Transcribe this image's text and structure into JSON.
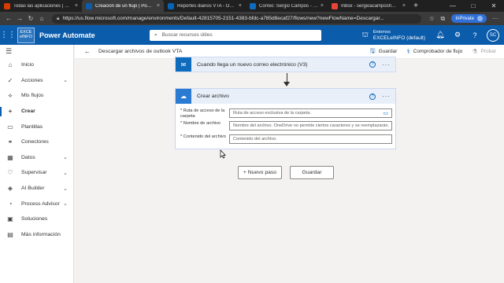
{
  "browser": {
    "tabs": [
      {
        "title": "Todas las aplicaciones | Micros",
        "color": "#d83b01"
      },
      {
        "title": "Creación de un flujo | Power Au",
        "color": "#0b5cab"
      },
      {
        "title": "Reportes diarios VTA - OneDrive",
        "color": "#0364b8"
      },
      {
        "title": "Correo: Sergio Campos - Outlook",
        "color": "#0f6cbd"
      },
      {
        "title": "Inbox - sergioacamposh@gmail.",
        "color": "#ea4335"
      }
    ],
    "url": "https://us.flow.microsoft.com/manage/environments/Default-42815705-2151-4383-bfdc-a785d8ecaf27/flows/new?newFlowName=Descargar...",
    "inprivate_label": "InPrivate"
  },
  "app": {
    "logo_line1": "EXCE",
    "logo_line2": "elNFO",
    "brand": "Power Automate",
    "search_placeholder": "Buscar recursos útiles",
    "env_label": "Entornos",
    "env_name": "EXCELeINFO (default)",
    "user_initials": "SC"
  },
  "sidebar": {
    "items": [
      {
        "label": "Inicio",
        "icon": "⌂",
        "chevron": false
      },
      {
        "label": "Acciones",
        "icon": "✓",
        "chevron": true
      },
      {
        "label": "Mis flujos",
        "icon": "⟡",
        "chevron": false
      },
      {
        "label": "Crear",
        "icon": "+",
        "chevron": false,
        "active": true
      },
      {
        "label": "Plantillas",
        "icon": "▭",
        "chevron": false
      },
      {
        "label": "Conectores",
        "icon": "⚭",
        "chevron": false
      },
      {
        "label": "Datos",
        "icon": "▦",
        "chevron": true
      },
      {
        "label": "Supervisar",
        "icon": "♡",
        "chevron": true
      },
      {
        "label": "AI Builder",
        "icon": "◈",
        "chevron": true
      },
      {
        "label": "Process Advisor",
        "icon": "◔",
        "chevron": true
      },
      {
        "label": "Soluciones",
        "icon": "▣",
        "chevron": false
      },
      {
        "label": "Más información",
        "icon": "▤",
        "chevron": false
      }
    ]
  },
  "commandbar": {
    "breadcrumb": "Descargar archivos de outlook VTA",
    "save": "Guardar",
    "checker": "Comprobador de flujo",
    "test": "Probar"
  },
  "trigger": {
    "title": "Cuando llega un nuevo correo electrónico (V3)"
  },
  "action": {
    "title": "Crear archivo",
    "fields": [
      {
        "label": "* Ruta de acceso de la carpeta",
        "placeholder": "Ruta de acceso exclusiva de la carpeta."
      },
      {
        "label": "* Nombre de archivo",
        "placeholder": "Nombre del archivo. OneDrive no permite ciertos caracteres y se reemplazarán."
      },
      {
        "label": "* Contenido del archivo",
        "placeholder": "Contenido del archivo."
      }
    ]
  },
  "buttons": {
    "new_step": "+ Nuevo paso",
    "save": "Guardar"
  }
}
